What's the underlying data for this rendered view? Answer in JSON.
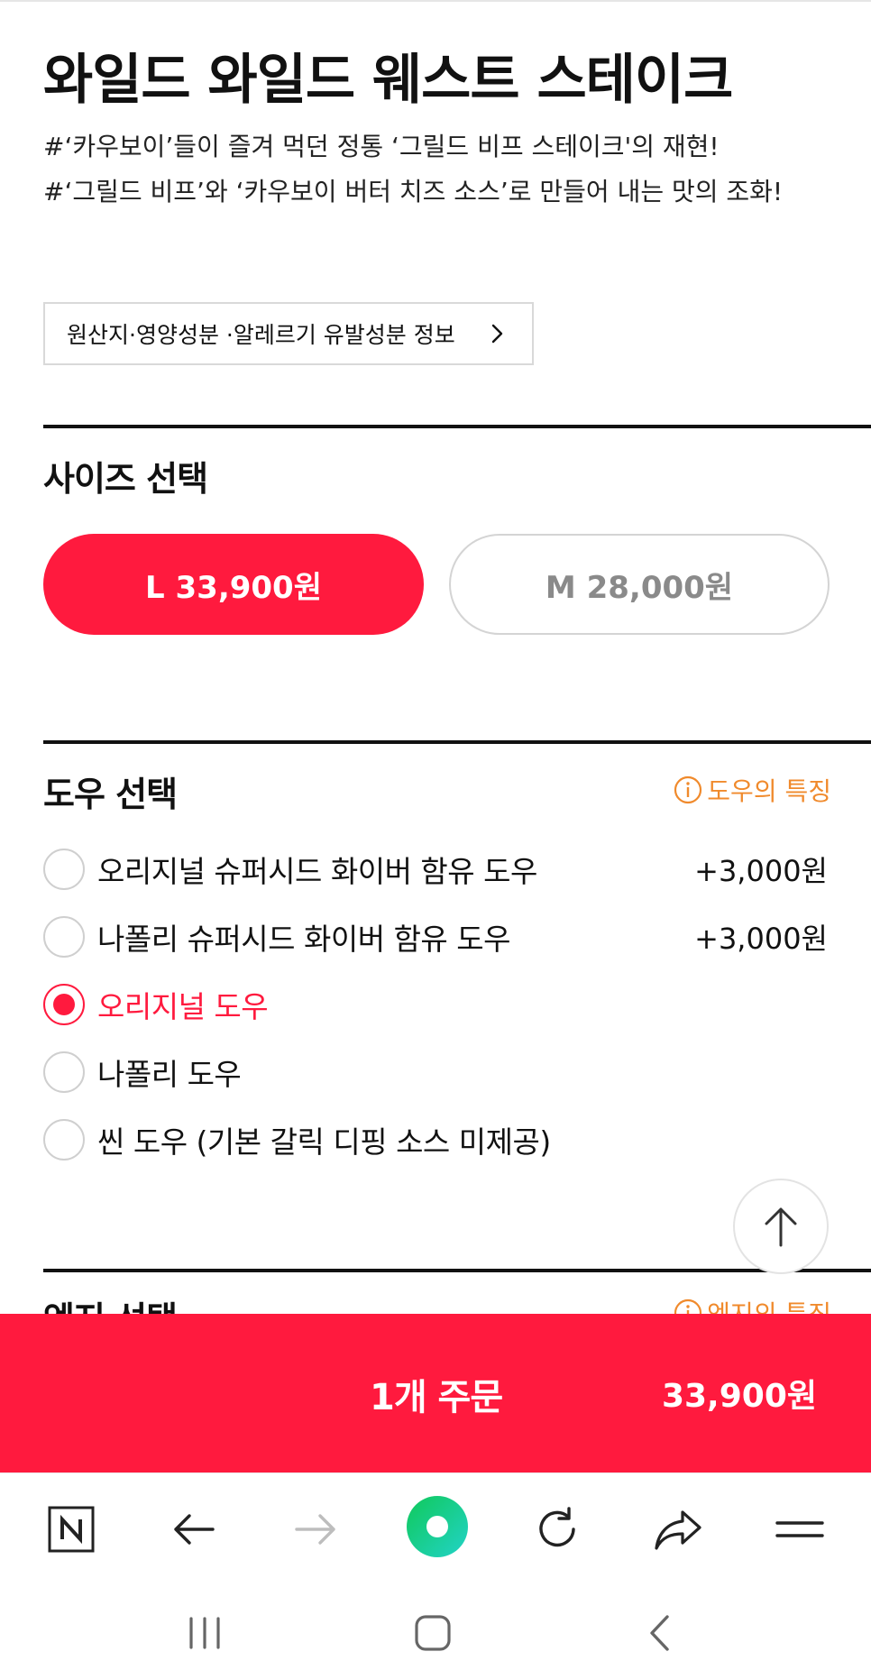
{
  "product": {
    "title": "와일드 와일드 웨스트 스테이크",
    "desc_lines": [
      "#‘카우보이’들이 즐겨 먹던 정통 ‘그릴드 비프 스테이크'의 재현!",
      "#‘그릴드 비프’와 ‘카우보이 버터 치즈 소스’로 만들어 내는 맛의 조화!"
    ],
    "info_button": "원산지·영양성분 ·알레르기 유발성분 정보"
  },
  "size": {
    "title": "사이즈 선택",
    "options": [
      {
        "label": "L 33,900원",
        "selected": true
      },
      {
        "label": "M 28,000원",
        "selected": false
      }
    ]
  },
  "dough": {
    "title": "도우 선택",
    "feature_link": "도우의 특징",
    "options": [
      {
        "label": "오리지널 슈퍼시드 화이버 함유 도우",
        "price": "+3,000원",
        "selected": false
      },
      {
        "label": "나폴리 슈퍼시드 화이버 함유 도우",
        "price": "+3,000원",
        "selected": false
      },
      {
        "label": "오리지널 도우",
        "price": "",
        "selected": true
      },
      {
        "label": "나폴리 도우",
        "price": "",
        "selected": false
      },
      {
        "label": "씬 도우 (기본 갈릭 디핑 소스 미제공)",
        "price": "",
        "selected": false
      }
    ]
  },
  "edge": {
    "title": "엣지 선택",
    "feature_link": "엣지의 특징"
  },
  "order": {
    "label": "1개 주문",
    "price": "33,900원"
  },
  "colors": {
    "accent": "#ff1a3e",
    "feature_link": "#f08a2c",
    "browser_home": "#18c964"
  },
  "icons": {
    "browser": [
      "naver-n-icon",
      "back-arrow-icon",
      "forward-arrow-icon",
      "home-green-circle-icon",
      "refresh-icon",
      "share-icon",
      "menu-icon"
    ],
    "system_nav": [
      "recent-apps-icon",
      "home-icon",
      "back-icon"
    ]
  }
}
